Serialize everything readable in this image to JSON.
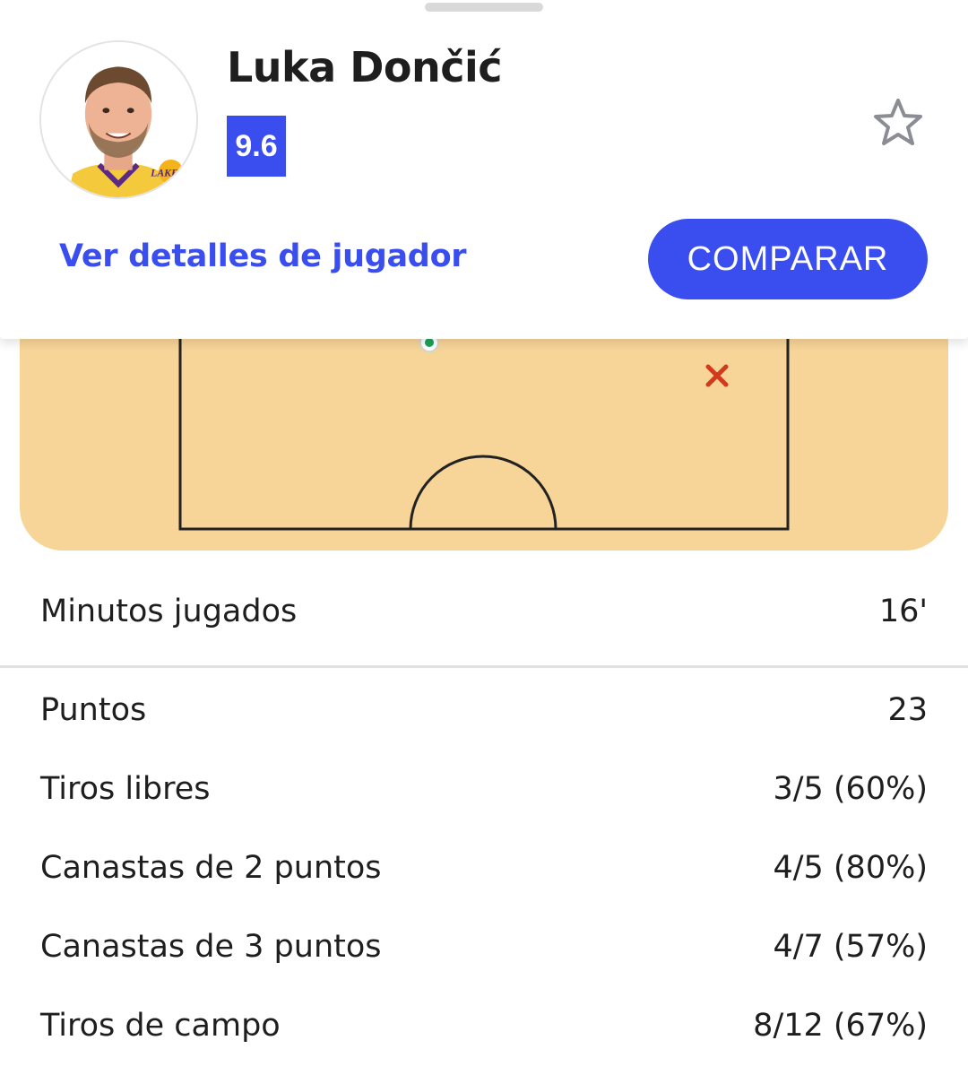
{
  "player": {
    "name": "Luka Dončić",
    "rating": "9.6",
    "rating_color": "#3a4ef0",
    "team_logo_icon": "lakers-logo"
  },
  "actions": {
    "details_link": "Ver detalles de jugador",
    "compare_button": "COMPARAR",
    "favorite_icon": "star-outline-icon"
  },
  "shot_chart": {
    "made_shot_color": "#1aa35a",
    "missed_shot_color": "#d23a1e",
    "court_color": "#f7d598"
  },
  "stats": {
    "minutes": {
      "label": "Minutos jugados",
      "value": "16'"
    },
    "rows": [
      {
        "label": "Puntos",
        "value": "23"
      },
      {
        "label": "Tiros libres",
        "value": "3/5 (60%)"
      },
      {
        "label": "Canastas de 2 puntos",
        "value": "4/5 (80%)"
      },
      {
        "label": "Canastas de 3 puntos",
        "value": "4/7 (57%)"
      },
      {
        "label": "Tiros de campo",
        "value": "8/12 (67%)"
      }
    ]
  }
}
